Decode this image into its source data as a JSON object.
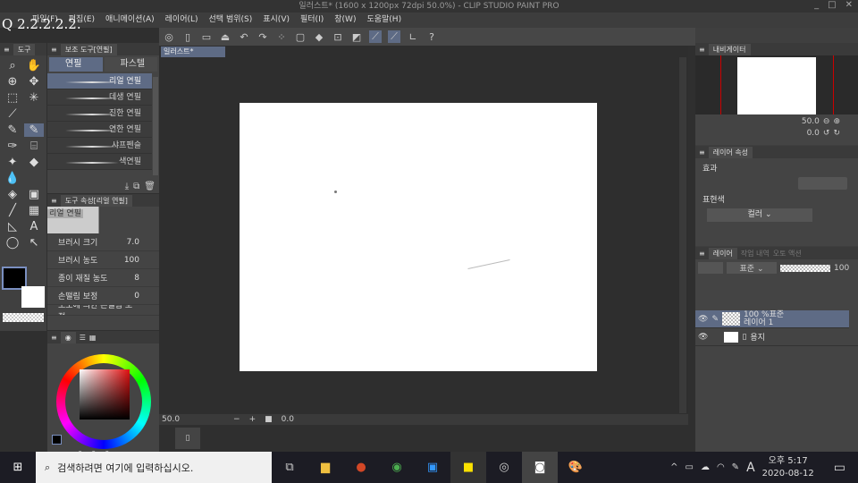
{
  "window": {
    "title": "일러스트* (1600 x 1200px 72dpi 50.0%) - CLIP STUDIO PAINT PRO",
    "minimize": "_",
    "maximize": "□",
    "close": "✕"
  },
  "menu": [
    "파일(F)",
    "편집(E)",
    "애니메이션(A)",
    "레이어(L)",
    "선택 범위(S)",
    "표시(V)",
    "필터(I)",
    "창(W)",
    "도움말(H)"
  ],
  "scribble": "Q 2.2.2.2.2.",
  "tool_panel": {
    "title": "도구"
  },
  "sub_tool": {
    "title": "보조 도구[연필]",
    "tabs": [
      "연필",
      "파스텔"
    ],
    "brushes": [
      "리얼 연필",
      "데생 연필",
      "진한 연필",
      "연한 연필",
      "샤프펜슬",
      "색연필"
    ]
  },
  "tool_property": {
    "title": "도구 속성[리얼 연필]",
    "preview_label": "리얼 연필",
    "rows": [
      {
        "label": "브러시 크기",
        "value": "7.0"
      },
      {
        "label": "브러시 농도",
        "value": "100"
      },
      {
        "label": "종이 재질 농도",
        "value": "8"
      },
      {
        "label": "손떨림 보정",
        "value": "0"
      }
    ],
    "cut_row": "소도에 의한 손떨림 보정"
  },
  "color": {
    "h": "0",
    "s": "0",
    "v": "0",
    "accent": "#e01010"
  },
  "canvas": {
    "tab": "일러스트*",
    "zoom": "50.0",
    "angle": "0.0"
  },
  "navigator": {
    "title": "내비게이터",
    "zoom": "50.0",
    "angle": "0.0"
  },
  "layer_property": {
    "title": "레이어 속성",
    "effect": "효과",
    "expression": "표현색",
    "color_mode": "컬러"
  },
  "layers": {
    "tabs": [
      "레이어",
      "작업 내역",
      "오토 액션"
    ],
    "blend": "표준",
    "opacity": "100",
    "items": [
      {
        "line1": "100 %표준",
        "line2": "레이어 1",
        "selected": true
      },
      {
        "line1": "",
        "line2": "용지",
        "selected": false
      }
    ]
  },
  "taskbar": {
    "search_placeholder": "검색하려면 여기에 입력하십시오.",
    "time": "오후 5:17",
    "date": "2020-08-12",
    "ime": "A"
  }
}
